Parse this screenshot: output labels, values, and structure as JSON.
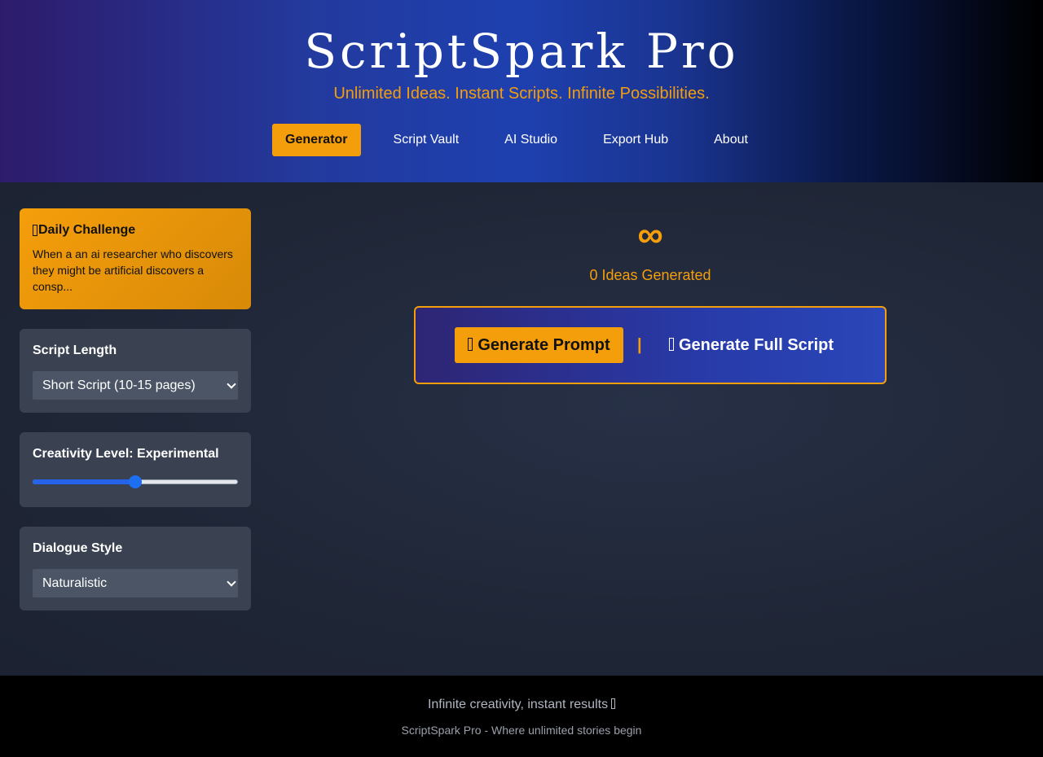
{
  "header": {
    "title": "ScriptSpark Pro",
    "tagline": "Unlimited Ideas. Instant Scripts. Infinite Possibilities.",
    "nav": [
      {
        "label": "Generator",
        "active": true
      },
      {
        "label": "Script Vault",
        "active": false
      },
      {
        "label": "AI Studio",
        "active": false
      },
      {
        "label": "Export Hub",
        "active": false
      },
      {
        "label": "About",
        "active": false
      }
    ]
  },
  "sidebar": {
    "challenge": {
      "title": "Daily Challenge",
      "text": "When a an ai researcher who discovers they might be artificial discovers a consp..."
    },
    "length": {
      "label": "Script Length",
      "selected": "Short Script (10-15 pages)"
    },
    "creativity": {
      "label": "Creativity Level: Experimental",
      "level": 0.5
    },
    "dialogue": {
      "label": "Dialogue Style",
      "selected": "Naturalistic"
    }
  },
  "main": {
    "symbol": "∞",
    "counter": "0 Ideas Generated",
    "generate_prompt_label": "Generate Prompt",
    "divider": "|",
    "generate_script_label": "Generate Full Script"
  },
  "footer": {
    "main": "Infinite creativity, instant results",
    "sub": "ScriptSpark Pro - Where unlimited stories begin"
  },
  "colors": {
    "accent": "#f59e0b",
    "header_blue": "#1e40af",
    "slider_blue": "#2563eb",
    "background": "#1e2433"
  }
}
